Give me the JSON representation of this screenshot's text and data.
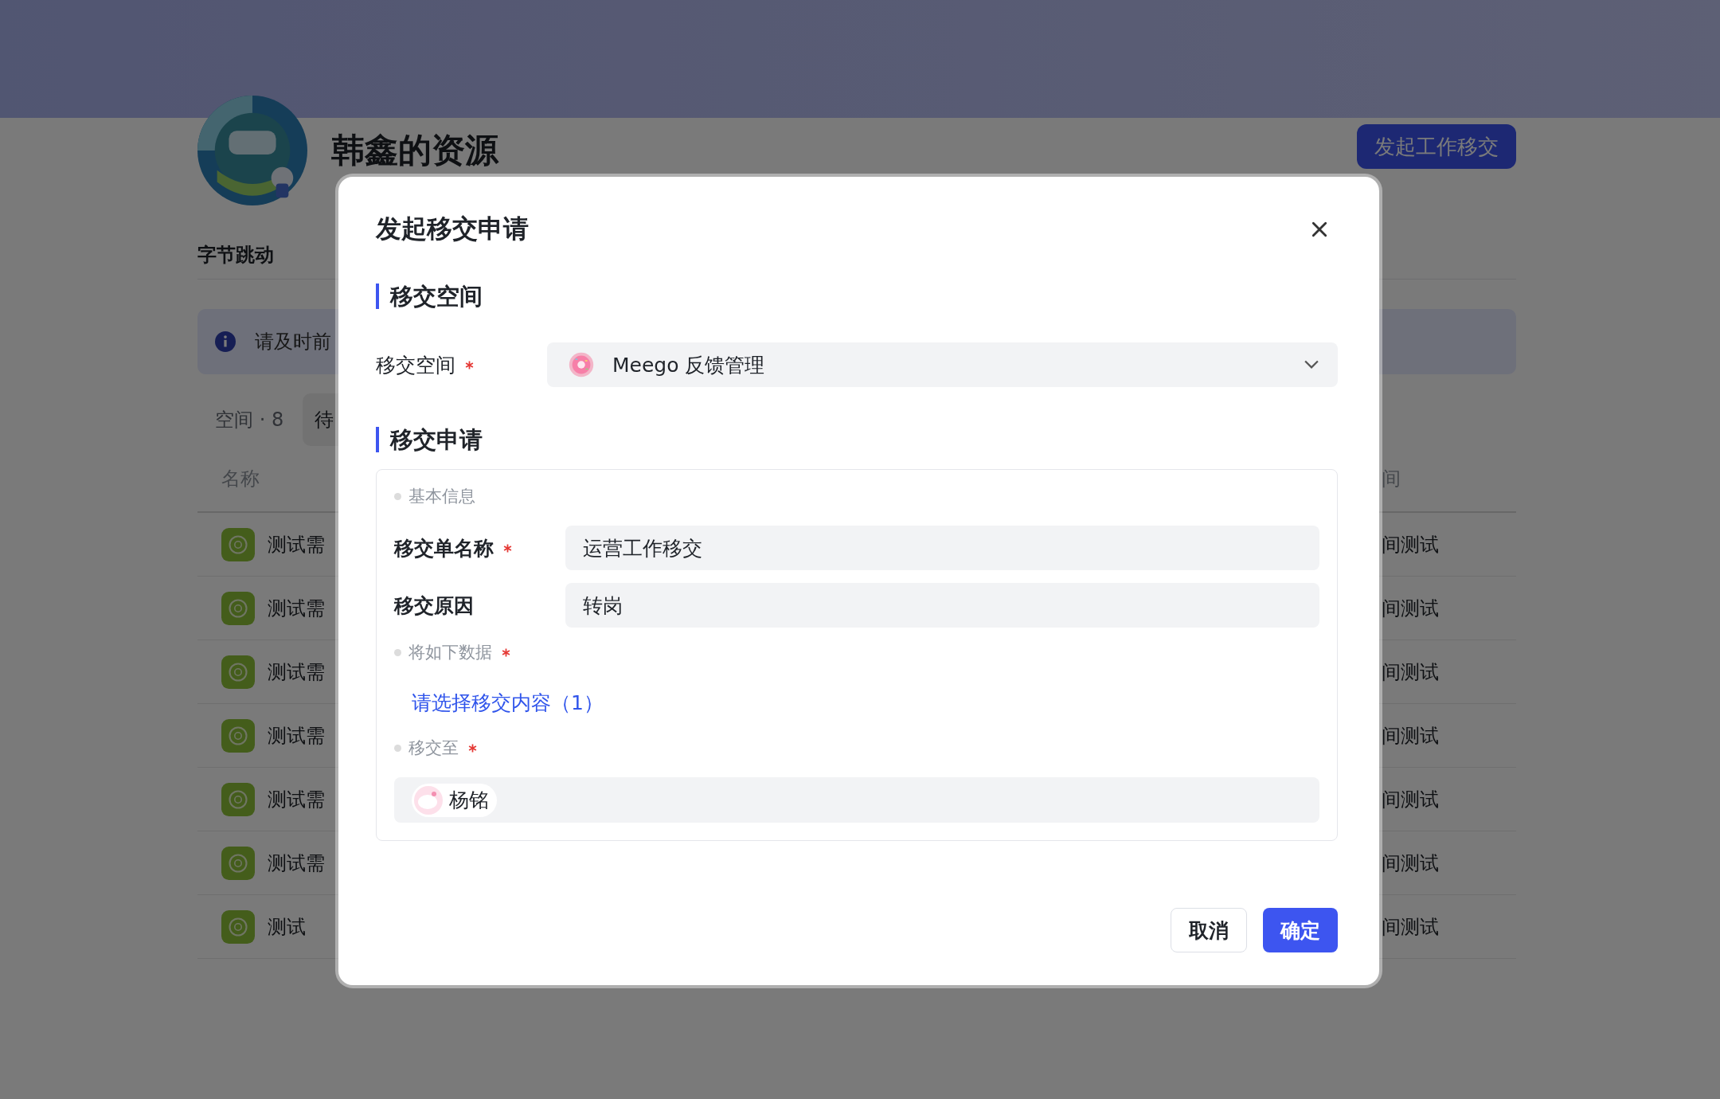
{
  "page": {
    "title": "韩鑫的资源",
    "action_button": "发起工作移交",
    "org": "字节跳动",
    "notice": "请及时前",
    "space_count": "空间 · 8",
    "tab_label": "待",
    "columns": [
      "名称",
      "间"
    ],
    "rows": [
      {
        "name": "测试需",
        "column_2": "间测试"
      },
      {
        "name": "测试需",
        "column_2": "间测试"
      },
      {
        "name": "测试需",
        "column_2": "间测试"
      },
      {
        "name": "测试需",
        "column_2": "间测试"
      },
      {
        "name": "测试需",
        "column_2": "间测试"
      },
      {
        "name": "测试需",
        "column_2": "间测试"
      },
      {
        "name": "测试",
        "column_2": "间测试"
      }
    ]
  },
  "dialog": {
    "title": "发起移交申请",
    "space_section": {
      "title": "移交空间",
      "label": "移交空间",
      "required": true,
      "value": "Meego 反馈管理"
    },
    "request_section": {
      "title": "移交申请",
      "basic_caption": "基本信息",
      "fields": [
        {
          "label": "移交单名称",
          "required": true,
          "value": "运营工作移交"
        },
        {
          "label": "移交原因",
          "required": false,
          "value": "转岗"
        }
      ],
      "data_caption": "将如下数据",
      "data_required": true,
      "data_link": "请选择移交内容（1）",
      "to_caption": "移交至",
      "to_required": true,
      "assignee": "杨铭"
    },
    "buttons": [
      {
        "label": "取消",
        "kind": "secondary"
      },
      {
        "label": "确定",
        "kind": "primary"
      }
    ]
  }
}
